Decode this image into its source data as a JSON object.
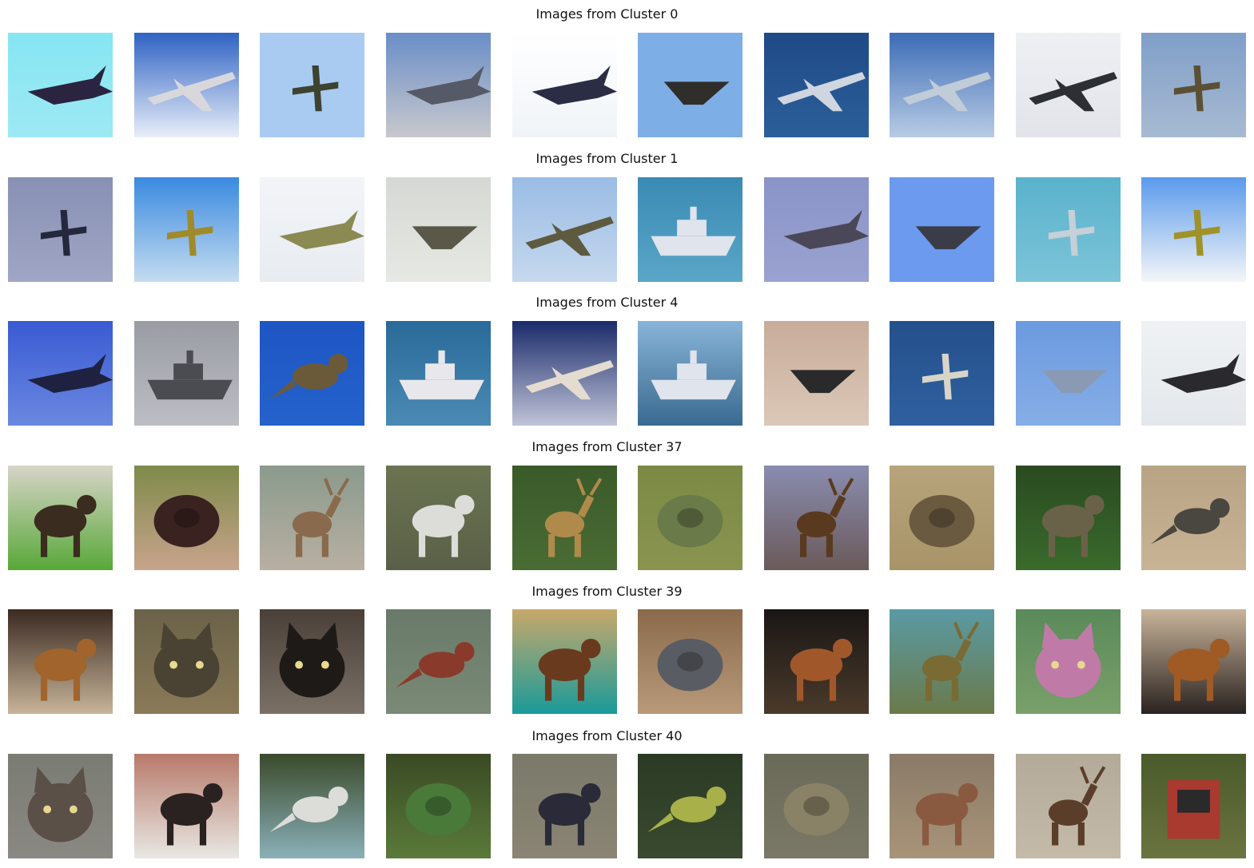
{
  "figure": {
    "clusters": [
      {
        "title": "Images from Cluster 0",
        "images": [
          {
            "subject": "airplane",
            "bg": "#86e6f2",
            "bg2": "#9de9f4",
            "fg": "#2a2440",
            "shape": "jet"
          },
          {
            "subject": "airplane",
            "bg": "#2f63c4",
            "bg2": "#e8eef8",
            "fg": "#d8d8dc",
            "shape": "airliner"
          },
          {
            "subject": "airplane",
            "bg": "#a9cbf2",
            "bg2": "#a9cbf2",
            "fg": "#3d4330",
            "shape": "small-plane"
          },
          {
            "subject": "airplane",
            "bg": "#6a8ec8",
            "bg2": "#c8c8cc",
            "fg": "#555a66",
            "shape": "jet"
          },
          {
            "subject": "airplane",
            "bg": "#ffffff",
            "bg2": "#f0f4f8",
            "fg": "#2a2d44",
            "shape": "jet"
          },
          {
            "subject": "airplane",
            "bg": "#7eaee6",
            "bg2": "#7eaee6",
            "fg": "#2f2e2a",
            "shape": "delta"
          },
          {
            "subject": "airplane",
            "bg": "#1f4a86",
            "bg2": "#2b5f9a",
            "fg": "#cfd6e0",
            "shape": "airliner"
          },
          {
            "subject": "airplane",
            "bg": "#3c6cb6",
            "bg2": "#b8cbe4",
            "fg": "#c0ccd8",
            "shape": "airliner"
          },
          {
            "subject": "airplane",
            "bg": "#eef0f4",
            "bg2": "#e2e4ea",
            "fg": "#2c3035",
            "shape": "airliner"
          },
          {
            "subject": "airplane",
            "bg": "#7f9fc8",
            "bg2": "#a8bad2",
            "fg": "#5c5034",
            "shape": "small-plane"
          }
        ]
      },
      {
        "title": "Images from Cluster 1",
        "images": [
          {
            "subject": "airplane",
            "bg": "#8890b4",
            "bg2": "#a0a6c4",
            "fg": "#24283c",
            "shape": "small-plane"
          },
          {
            "subject": "airplane",
            "bg": "#3a8ae0",
            "bg2": "#c4dcf0",
            "fg": "#a08a2a",
            "shape": "small-plane"
          },
          {
            "subject": "airplane",
            "bg": "#f2f4f8",
            "bg2": "#e8ecf0",
            "fg": "#8a8a52",
            "shape": "jet"
          },
          {
            "subject": "airplane",
            "bg": "#d6d8d4",
            "bg2": "#e6e8e4",
            "fg": "#5a5848",
            "shape": "delta"
          },
          {
            "subject": "airplane",
            "bg": "#9abce4",
            "bg2": "#c6d8ee",
            "fg": "#5e5a40",
            "shape": "airliner"
          },
          {
            "subject": "ship",
            "bg": "#3a8ab4",
            "bg2": "#5aa6c8",
            "fg": "#e0e4ec",
            "shape": "ship"
          },
          {
            "subject": "airplane",
            "bg": "#8a94c8",
            "bg2": "#9aa2d0",
            "fg": "#4a4858",
            "shape": "jet"
          },
          {
            "subject": "airplane",
            "bg": "#6c9aee",
            "bg2": "#6c9aee",
            "fg": "#3a3c48",
            "shape": "delta"
          },
          {
            "subject": "airplane",
            "bg": "#5ab2cc",
            "bg2": "#7cc4d8",
            "fg": "#c6d0d8",
            "shape": "small-plane"
          },
          {
            "subject": "airplane",
            "bg": "#5a9aec",
            "bg2": "#f4f6f8",
            "fg": "#a09228",
            "shape": "small-plane"
          }
        ]
      },
      {
        "title": "Images from Cluster 4",
        "images": [
          {
            "subject": "airplane",
            "bg": "#3a5ad4",
            "bg2": "#6a88e0",
            "fg": "#1e2240",
            "shape": "jet"
          },
          {
            "subject": "ship",
            "bg": "#9a9ca4",
            "bg2": "#bcbec4",
            "fg": "#4a4c52",
            "shape": "ship"
          },
          {
            "subject": "bird",
            "bg": "#1e56c4",
            "bg2": "#2462cc",
            "fg": "#6a5a3a",
            "shape": "bird"
          },
          {
            "subject": "boat",
            "bg": "#2a6a9a",
            "bg2": "#4a8ab4",
            "fg": "#e8e8ec",
            "shape": "ship"
          },
          {
            "subject": "airplane",
            "bg": "#1a2a6a",
            "bg2": "#c0c4d8",
            "fg": "#e4dcd0",
            "shape": "airliner"
          },
          {
            "subject": "ship",
            "bg": "#88b4d8",
            "bg2": "#3a6a90",
            "fg": "#e0e4ec",
            "shape": "ship"
          },
          {
            "subject": "airplane",
            "bg": "#c8ac9a",
            "bg2": "#dcc8b8",
            "fg": "#2a2a2c",
            "shape": "delta"
          },
          {
            "subject": "airplane",
            "bg": "#24508c",
            "bg2": "#3060a0",
            "fg": "#d8d4c8",
            "shape": "small-plane"
          },
          {
            "subject": "airplane",
            "bg": "#6c9ae0",
            "bg2": "#86aee6",
            "fg": "#8a9ab4",
            "shape": "delta"
          },
          {
            "subject": "airplane",
            "bg": "#eef2f4",
            "bg2": "#e4e8ec",
            "fg": "#2a2a2e",
            "shape": "jet"
          }
        ]
      },
      {
        "title": "Images from Cluster 37",
        "images": [
          {
            "subject": "dog",
            "bg": "#d8d4c8",
            "bg2": "#58a838",
            "fg": "#3a2c1e",
            "shape": "animal"
          },
          {
            "subject": "dog",
            "bg": "#7e8a4a",
            "bg2": "#c8a48c",
            "fg": "#3a2220",
            "shape": "blob"
          },
          {
            "subject": "deer",
            "bg": "#8a9a8c",
            "bg2": "#b8b0a2",
            "fg": "#8a6a4c",
            "shape": "deer"
          },
          {
            "subject": "horse",
            "bg": "#6a7450",
            "bg2": "#5a6048",
            "fg": "#dcdcd8",
            "shape": "animal"
          },
          {
            "subject": "deer",
            "bg": "#3a5a2a",
            "bg2": "#4a6c34",
            "fg": "#b08a4a",
            "shape": "deer"
          },
          {
            "subject": "frog",
            "bg": "#7a8a44",
            "bg2": "#8a9450",
            "fg": "#6a7a48",
            "shape": "blob"
          },
          {
            "subject": "deer",
            "bg": "#8a8cb0",
            "bg2": "#6a5a5a",
            "fg": "#5a3a1e",
            "shape": "deer"
          },
          {
            "subject": "animal",
            "bg": "#b8a47c",
            "bg2": "#a89468",
            "fg": "#6a5a40",
            "shape": "blob"
          },
          {
            "subject": "animal",
            "bg": "#2a4a20",
            "bg2": "#3a6a2c",
            "fg": "#6a6248",
            "shape": "animal"
          },
          {
            "subject": "bird",
            "bg": "#b8a484",
            "bg2": "#c8b494",
            "fg": "#4a4640",
            "shape": "bird"
          }
        ]
      },
      {
        "title": "Images from Cluster 39",
        "images": [
          {
            "subject": "dog",
            "bg": "#3a2a20",
            "bg2": "#c8b49a",
            "fg": "#a0642c",
            "shape": "animal"
          },
          {
            "subject": "cat",
            "bg": "#6a6248",
            "bg2": "#8a7a58",
            "fg": "#4a4232",
            "shape": "cat"
          },
          {
            "subject": "cat",
            "bg": "#4a4038",
            "bg2": "#7a7066",
            "fg": "#1e1a18",
            "shape": "cat"
          },
          {
            "subject": "bird",
            "bg": "#6a7a6a",
            "bg2": "#7a8a76",
            "fg": "#8a3a2a",
            "shape": "bird"
          },
          {
            "subject": "horse",
            "bg": "#c8a86a",
            "bg2": "#1a9a9a",
            "fg": "#6a3a1e",
            "shape": "animal"
          },
          {
            "subject": "cat",
            "bg": "#8a6a4a",
            "bg2": "#b89a7a",
            "fg": "#5a5c64",
            "shape": "blob"
          },
          {
            "subject": "horse",
            "bg": "#1a1616",
            "bg2": "#4a3a2a",
            "fg": "#a0582a",
            "shape": "animal"
          },
          {
            "subject": "moose",
            "bg": "#5a9aa4",
            "bg2": "#6a7a4a",
            "fg": "#7a6a34",
            "shape": "deer"
          },
          {
            "subject": "cat",
            "bg": "#5a8a5a",
            "bg2": "#7aa06a",
            "fg": "#c07aa8",
            "shape": "cat"
          },
          {
            "subject": "dog",
            "bg": "#c8b49a",
            "bg2": "#2a2220",
            "fg": "#a05a24",
            "shape": "animal"
          }
        ]
      },
      {
        "title": "Images from Cluster 40",
        "images": [
          {
            "subject": "cat",
            "bg": "#7a7c74",
            "bg2": "#8a8882",
            "fg": "#5a5048",
            "shape": "cat"
          },
          {
            "subject": "horse",
            "bg": "#b87a6a",
            "bg2": "#e8e8e4",
            "fg": "#2a2220",
            "shape": "animal"
          },
          {
            "subject": "bird",
            "bg": "#3a4a2a",
            "bg2": "#8ab0b8",
            "fg": "#dcdcd8",
            "shape": "bird"
          },
          {
            "subject": "frog",
            "bg": "#3a4a24",
            "bg2": "#5a7a3a",
            "fg": "#4a7a3a",
            "shape": "blob"
          },
          {
            "subject": "animal",
            "bg": "#7a7a6a",
            "bg2": "#8a8474",
            "fg": "#2a2a38",
            "shape": "animal"
          },
          {
            "subject": "bird",
            "bg": "#2a3a24",
            "bg2": "#3a4a30",
            "fg": "#a8b04a",
            "shape": "bird"
          },
          {
            "subject": "frog",
            "bg": "#6a6a58",
            "bg2": "#7a7866",
            "fg": "#8a8266",
            "shape": "blob"
          },
          {
            "subject": "horse",
            "bg": "#8a7a68",
            "bg2": "#a89478",
            "fg": "#8a5a40",
            "shape": "animal"
          },
          {
            "subject": "deer",
            "bg": "#b4aa9a",
            "bg2": "#c4baa8",
            "fg": "#5a3e2a",
            "shape": "deer"
          },
          {
            "subject": "truck",
            "bg": "#4a5a2a",
            "bg2": "#6a7440",
            "fg": "#a83a30",
            "shape": "truck"
          }
        ]
      }
    ]
  }
}
